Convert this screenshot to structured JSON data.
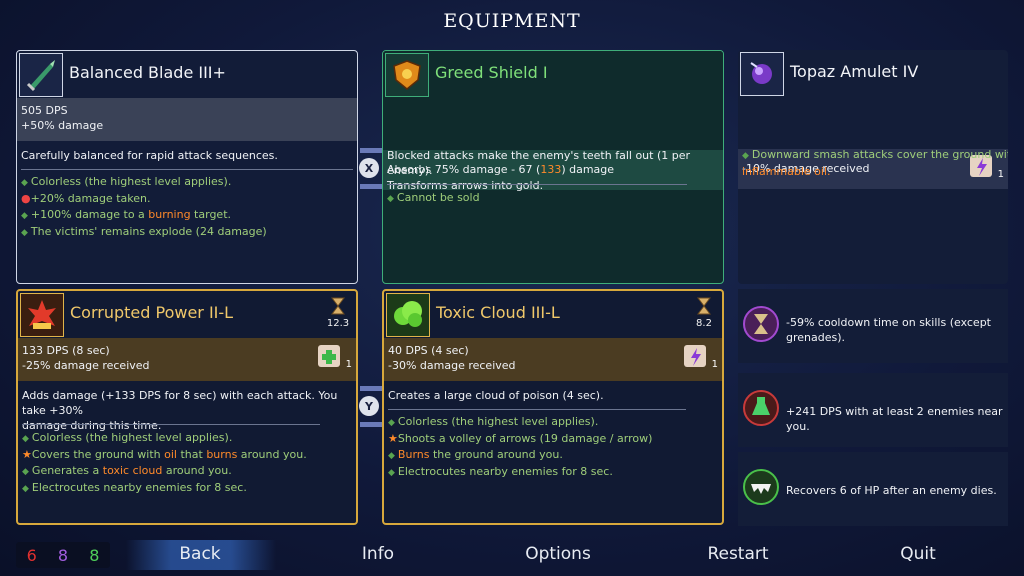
{
  "screen_title": "EQUIPMENT",
  "cards": {
    "balanced_blade": {
      "name": "Balanced Blade III+",
      "stat1": "505 DPS",
      "stat2": "+50% damage",
      "description": "Carefully balanced for rapid attack sequences.",
      "b1": "Colorless (the highest level applies).",
      "b2": "+20% damage taken.",
      "b3_pre": "+100% damage to a ",
      "b3_hl": "burning",
      "b3_post": " target.",
      "b4": "The victims' remains explode (24 damage)"
    },
    "greed_shield": {
      "name": "Greed Shield I",
      "stat_pre": "Absorbs 75% damage - 67 (",
      "stat_hl": "133",
      "stat_post": ") damage",
      "desc1": "Blocked attacks make the enemy's teeth fall out (1 per enemy).",
      "desc2": "Transforms arrows into gold.",
      "b1": "Cannot be sold"
    },
    "topaz_amulet": {
      "name": "Topaz Amulet IV",
      "stat": "-10% damage received",
      "scroll_count": "1",
      "b1": "Downward smash attacks cover the ground with",
      "b1_hl": "inflammable oil."
    },
    "corrupted_power": {
      "name": "Corrupted Power II-L",
      "cooldown": "12.3",
      "stat1": "133 DPS (8 sec)",
      "stat2": "-25% damage received",
      "scroll_count": "1",
      "desc1": "Adds damage (+133 DPS for 8 sec) with each attack. You take +30%",
      "desc2": "damage during this time.",
      "b1": "Colorless (the highest level applies).",
      "b2_pre": "Covers the ground with ",
      "b2_hl1": "oil",
      "b2_mid": " that ",
      "b2_hl2": "burns",
      "b2_post": " around you.",
      "b3_pre": "Generates a ",
      "b3_hl": "toxic cloud",
      "b3_post": " around you.",
      "b4": "Electrocutes nearby enemies for 8 sec."
    },
    "toxic_cloud": {
      "name": "Toxic Cloud III-L",
      "cooldown": "8.2",
      "stat1": "40 DPS (4 sec)",
      "stat2": "-30% damage received",
      "scroll_count": "1",
      "desc1": "Creates a large cloud of poison (4 sec).",
      "b1": "Colorless (the highest level applies).",
      "b2": "Shoots a volley of arrows (19 damage / arrow)",
      "b3_hl": "Burns",
      "b3_post": " the ground around you.",
      "b4": "Electrocutes nearby enemies for 8 sec."
    }
  },
  "mutations": [
    {
      "text1": "-59% cooldown time on skills (except",
      "text2": "grenades).",
      "icon": "hourglass-mutation-icon"
    },
    {
      "text1": "+241 DPS with at least 2 enemies near you.",
      "icon": "potion-mutation-icon"
    },
    {
      "text1": "Recovers 6 of HP after an enemy dies.",
      "icon": "fangs-mutation-icon"
    }
  ],
  "swap_buttons": {
    "top": "X",
    "bottom": "Y"
  },
  "scroll_counts": {
    "red": "6",
    "purple": "8",
    "green": "8"
  },
  "colors": {
    "red": "#e0302f",
    "purple": "#a35ee0",
    "green": "#4fcf5a",
    "gold": "#d7a83c",
    "shield_green": "#3fae7a"
  },
  "menu": {
    "back": "Back",
    "info": "Info",
    "options": "Options",
    "restart": "Restart",
    "quit": "Quit"
  }
}
